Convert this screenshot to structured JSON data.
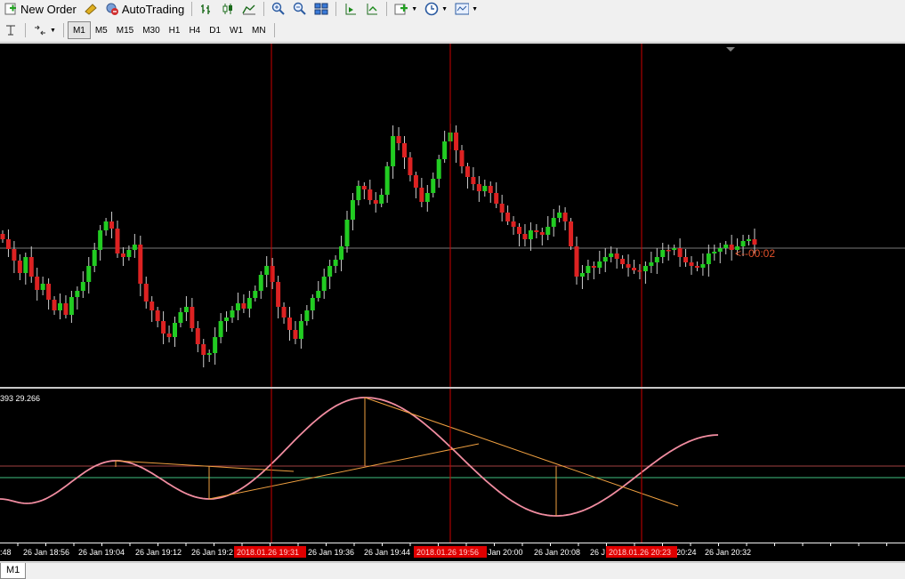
{
  "toolbar": {
    "new_order_label": "New Order",
    "autotrading_label": "AutoTrading"
  },
  "timeframes": [
    "M1",
    "M5",
    "M15",
    "M30",
    "H1",
    "H4",
    "D1",
    "W1",
    "MN"
  ],
  "active_timeframe": "M1",
  "countdown": "<--00:02",
  "indicator_label": "393 29.266",
  "time_labels": [
    {
      "text": ":48"
    },
    {
      "text": "26 Jan 18:56"
    },
    {
      "text": "26 Jan 19:04"
    },
    {
      "text": "26 Jan 19:12"
    },
    {
      "text": "26 Jan 19:2"
    },
    {
      "text": "26 Jan 19:36"
    },
    {
      "text": "26 Jan 19:44"
    },
    {
      "text": "Jan 20:00"
    },
    {
      "text": "26 Jan 20:08"
    },
    {
      "text": "26 J"
    },
    {
      "text": "20:24"
    },
    {
      "text": "26 Jan 20:32"
    }
  ],
  "cursor_labels": [
    "2018.01.26 19:31",
    "2018.01.26 19:56",
    "2018.01.26 20:23"
  ],
  "status_tab": "M1",
  "colors": {
    "bull": "#22cc22",
    "bear": "#dd2222",
    "oscillator": "#f08ca0",
    "trendline": "#f0a040",
    "vline": "#cc0000",
    "level_red": "#a04040",
    "level_green": "#40c080",
    "price_line": "#a0a0a0",
    "countdown": "#e0502a"
  }
}
